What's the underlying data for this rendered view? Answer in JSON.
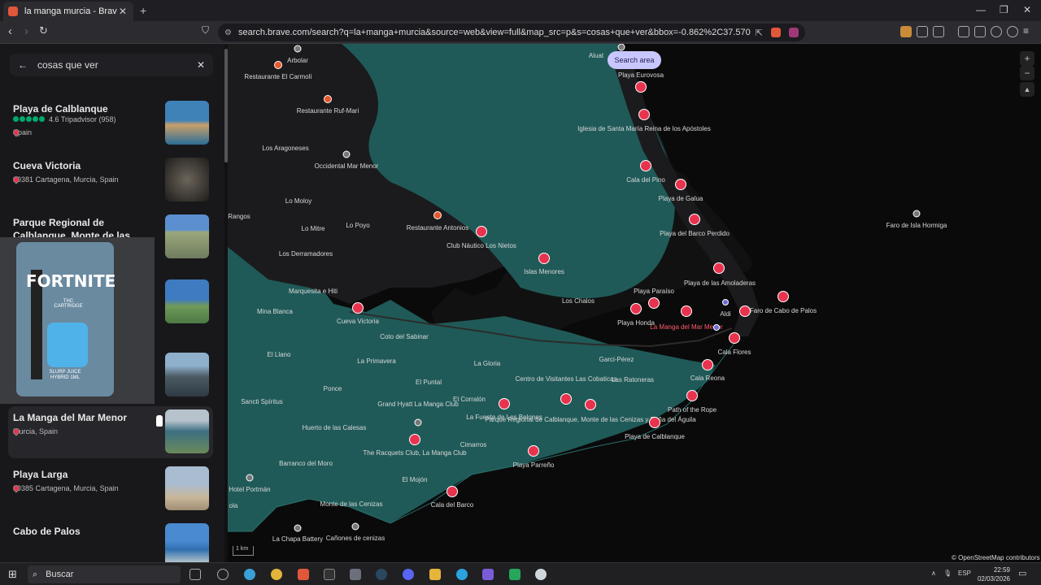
{
  "browser": {
    "tab_title": "la manga murcia - Brave Search",
    "url": "search.brave.com/search?q=la+manga+murcia&source=web&view=full&map_src=p&s=cosas+que+ver&bbox=-0.862%2C37.570%2C-0.611%2C37...",
    "new_tab": "+",
    "close": "✕"
  },
  "sidebar": {
    "query": "cosas que ver",
    "results": [
      {
        "name": "Playa de Calblanque",
        "rating": "4.6 Tripadvisor (958)",
        "location": "Spain",
        "thumb": "#3f82b8"
      },
      {
        "name": "Cueva Victoria",
        "location": "30381 Cartagena, Murcia, Spain",
        "thumb": "#3a3632"
      },
      {
        "name": "Parque Regional de Calblanque, Monte de las Cenizas y Peña del",
        "location": "",
        "thumb": "#7a8a6a"
      },
      {
        "name": "",
        "location": "",
        "thumb": "#4e7fb6"
      },
      {
        "name": "",
        "location": "",
        "thumb": "#5f6e78"
      },
      {
        "name": "La Manga del Mar Menor",
        "location": "Murcia, Spain",
        "thumb": "#5a7e8e"
      },
      {
        "name": "Playa Larga",
        "location": "30385 Cartagena, Murcia, Spain",
        "thumb": "#9fb1c1"
      },
      {
        "name": "Cabo de Palos",
        "location": "",
        "thumb": "#3a7fc0"
      }
    ]
  },
  "popup": {
    "brand": "FORTNITE",
    "line1": "THC CARTRIDGE",
    "line2": "SLURP JUICE HYBRID 1ML"
  },
  "map": {
    "search_area": "Search area",
    "zoom_in": "+",
    "zoom_out": "−",
    "scale": "1 km",
    "attribution": "© OpenStreetMap contributors",
    "labels": {
      "alua": "Aluat",
      "arbolar": "Arbolar",
      "carmoli": "Restaurante El Carmolí",
      "rufmari": "Restaurante Ruf-Mari",
      "aragoneses": "Los Aragoneses",
      "occidental": "Occidental Mar Menor",
      "moloy": "Lo Moloy",
      "rangos": "Rangos",
      "mitre": "Lo Mitre",
      "poyo": "Lo Poyo",
      "antonios": "Restaurante Antonios",
      "nautico": "Club Náutico Los Nietos",
      "derramadores": "Los Derramadores",
      "islas": "Islas Menores",
      "marquesita": "Marquesita e Hiti",
      "minablanca": "Mina Blanca",
      "cueva": "Cueva Victoria",
      "sabinar": "Coto del Sabinar",
      "chalos": "Los Chalos",
      "llano": "El Llano",
      "primavera": "La Primavera",
      "gloria": "La Gloria",
      "puntal": "El Puntal",
      "ponce": "Ponce",
      "sancti": "Sancti Spíritus",
      "corralon": "El Corralón",
      "fuente": "La Fuente de Los Belones",
      "grandhyatt": "Grand Hyatt La Manga Club",
      "huerto": "Huerto de las Calesas",
      "racquets": "The Racquets Club, La Manga Club",
      "cimarros": "Cimarros",
      "barranco": "Barranco del Moro",
      "mojon": "El Mojón",
      "portman": "Hotel Portmán",
      "cala": "ola",
      "monte": "Monte de las Cenizas",
      "calabarco": "Cala del Barco",
      "chapa": "La Chapa Battery",
      "canones": "Cañones de cenizas",
      "parreno": "Playa Parreño",
      "centro": "Centro de Visitantes Las Cobaticas",
      "parque": "Parque Regional de Calblanque, Monte de las Cenizas y Peña del Águila",
      "garci": "Garci-Pérez",
      "ratoneras": "Las Ratoneras",
      "calblanque": "Playa de Calblanque",
      "rope": "Path of the Rope",
      "reona": "Cala Reona",
      "flores": "Cala Flores",
      "lamanga": "La Manga del Mar Menor",
      "aldi": "Aldi",
      "faro": "Faro de Cabo de Palos",
      "amoladeras": "Playa de las Amoladeras",
      "paraiso": "Playa Paraíso",
      "honda": "Playa Honda",
      "barco": "Playa del Barco Perdido",
      "galua": "Playa de Galua",
      "calapino": "Cala del Pino",
      "iglesia": "Iglesia de Santa María Reina de los Apóstoles",
      "eurovosa": "Playa Eurovosa",
      "hormiga": "Faro de Isla Hormiga"
    }
  },
  "taskbar": {
    "search": "Buscar",
    "lang": "ESP",
    "time": "22:59",
    "date": "02/03/2026"
  },
  "colors": {
    "water": "#1f5a58",
    "land": "#1b1b1d",
    "pin": "#e8334f"
  }
}
